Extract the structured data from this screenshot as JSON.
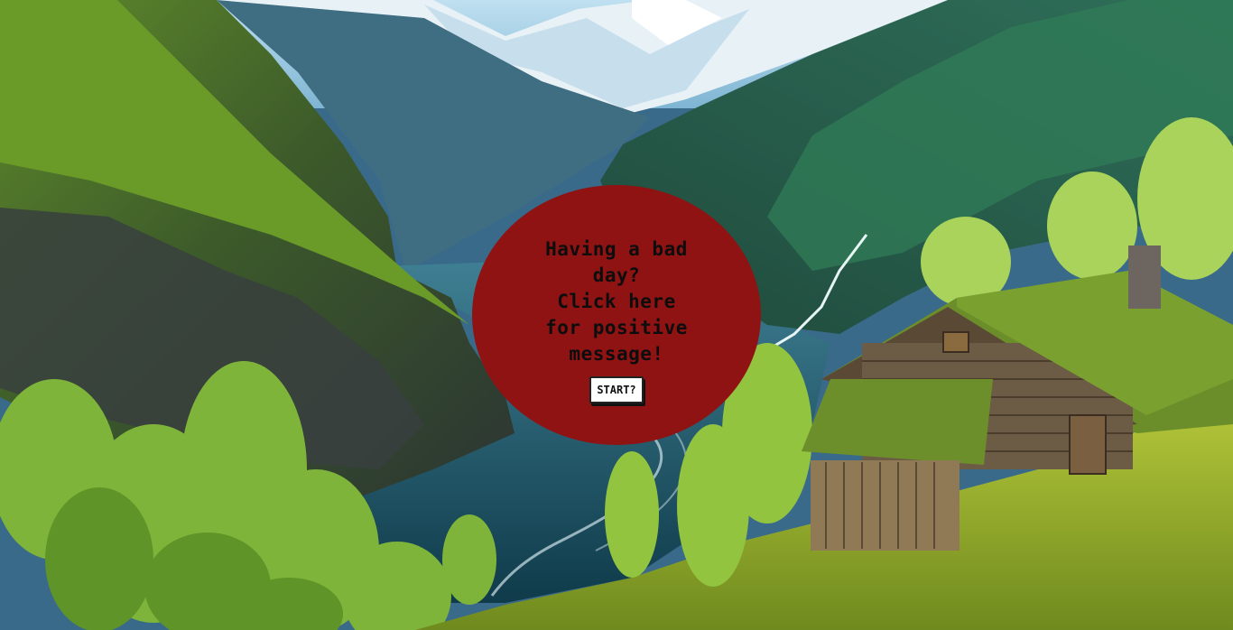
{
  "hero": {
    "message": "Having a bad\nday?\nClick here\nfor positive\nmessage!",
    "start_label": "START?"
  },
  "colors": {
    "bubble": "#8f1313",
    "button_bg": "#ffffff",
    "text": "#0d0d0d"
  },
  "background": {
    "description_icon": "fjord-landscape-image"
  }
}
